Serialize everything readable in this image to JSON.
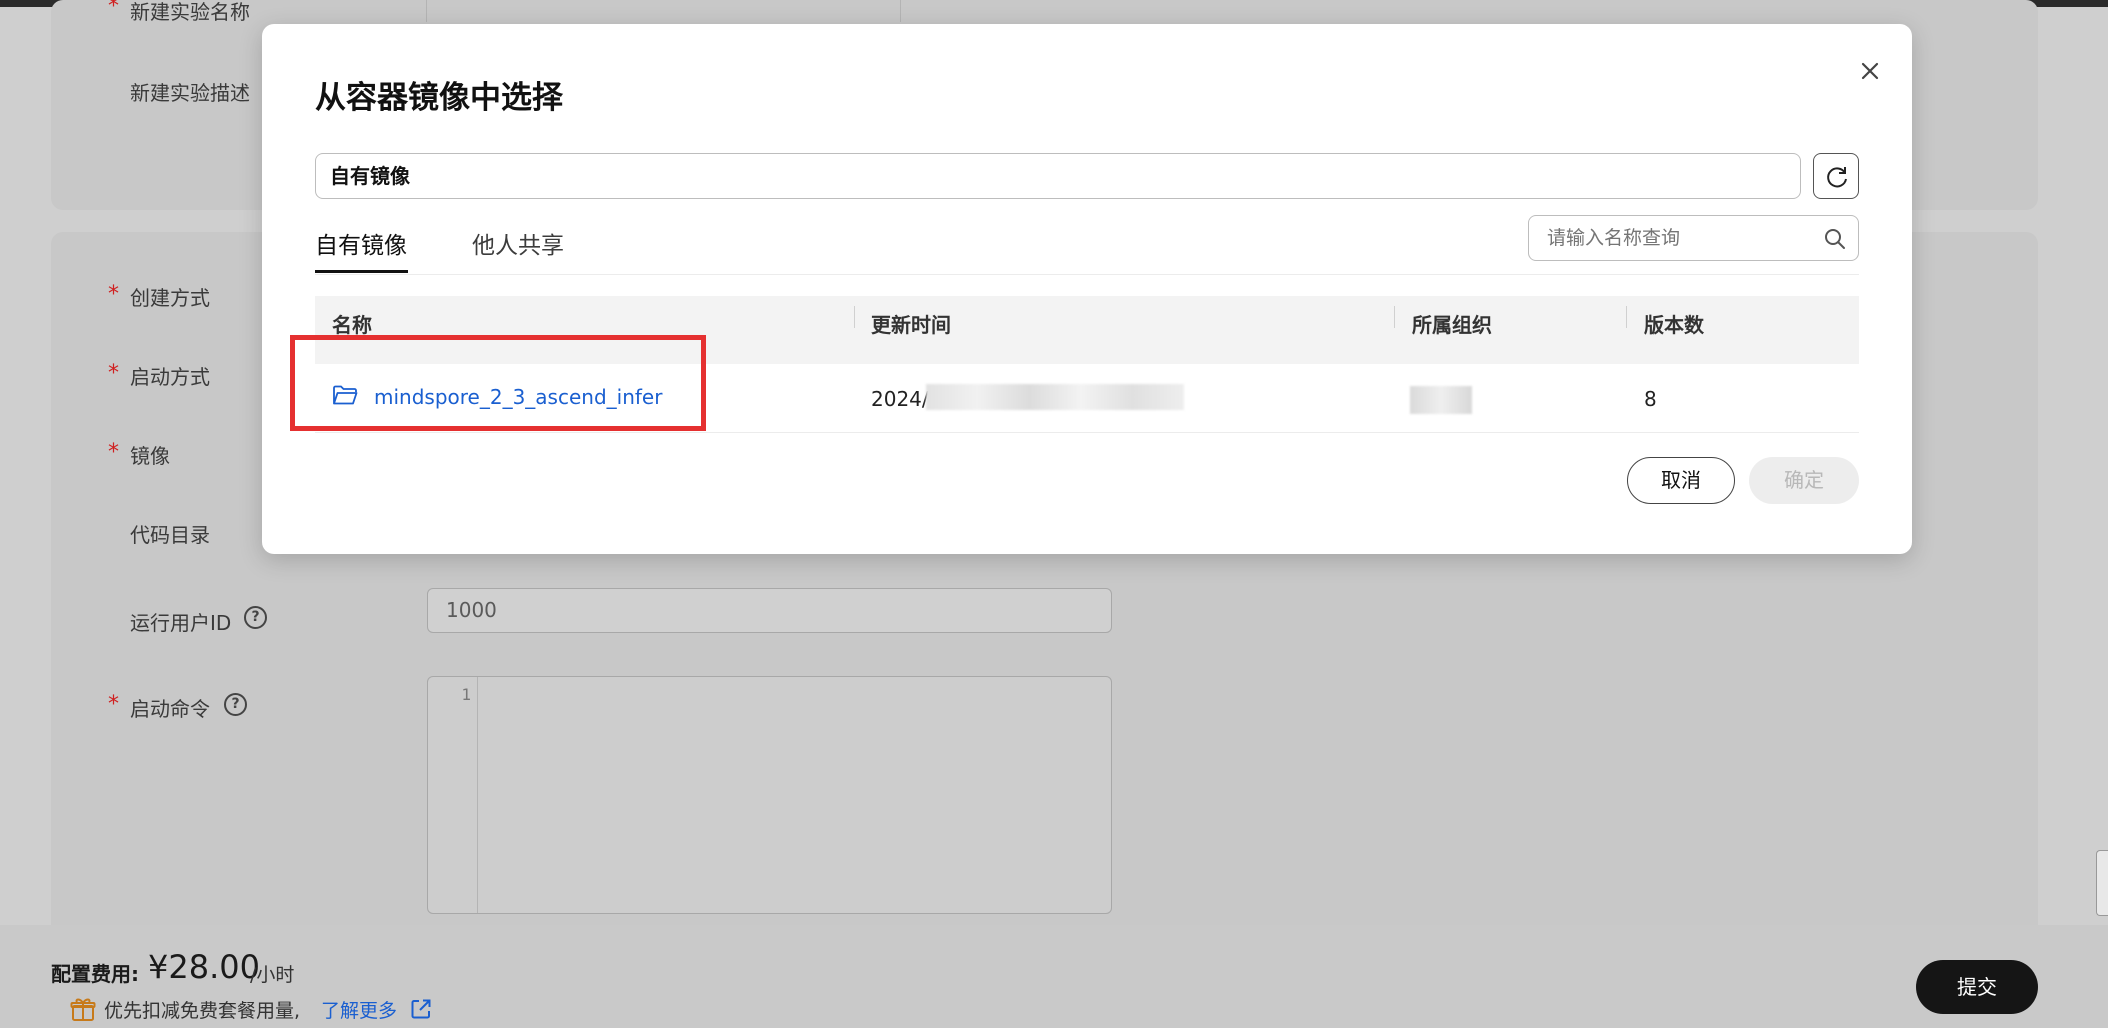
{
  "form": {
    "labels": {
      "experiment_name": "新建实验名称",
      "experiment_desc": "新建实验描述",
      "create_method": "创建方式",
      "start_method": "启动方式",
      "image": "镜像",
      "code_dir": "代码目录",
      "run_user_id": "运行用户ID",
      "start_command": "启动命令"
    },
    "required_mark": "*",
    "help_mark": "?",
    "run_user_id_value": "1000",
    "editor_line_number": "1"
  },
  "footer": {
    "fee_label": "配置费用:",
    "fee_price": "¥28.00",
    "fee_unit": "/小时",
    "note": "优先扣减免费套餐用量,",
    "link": "了解更多",
    "submit": "提交"
  },
  "modal": {
    "title": "从容器镜像中选择",
    "source_select_value": "自有镜像",
    "tabs": [
      {
        "label": "自有镜像",
        "active": true
      },
      {
        "label": "他人共享",
        "active": false
      }
    ],
    "search_placeholder": "请输入名称查询",
    "table": {
      "columns": [
        "名称",
        "更新时间",
        "所属组织",
        "版本数"
      ],
      "rows": [
        {
          "name": "mindspore_2_3_ascend_infer",
          "updated_prefix": "2024/",
          "versions": "8"
        }
      ]
    },
    "cancel": "取消",
    "confirm": "确定"
  },
  "colors": {
    "link": "#1a5fd0",
    "highlight": "#e53030",
    "required": "#d02020",
    "primary_button": "#151515"
  }
}
